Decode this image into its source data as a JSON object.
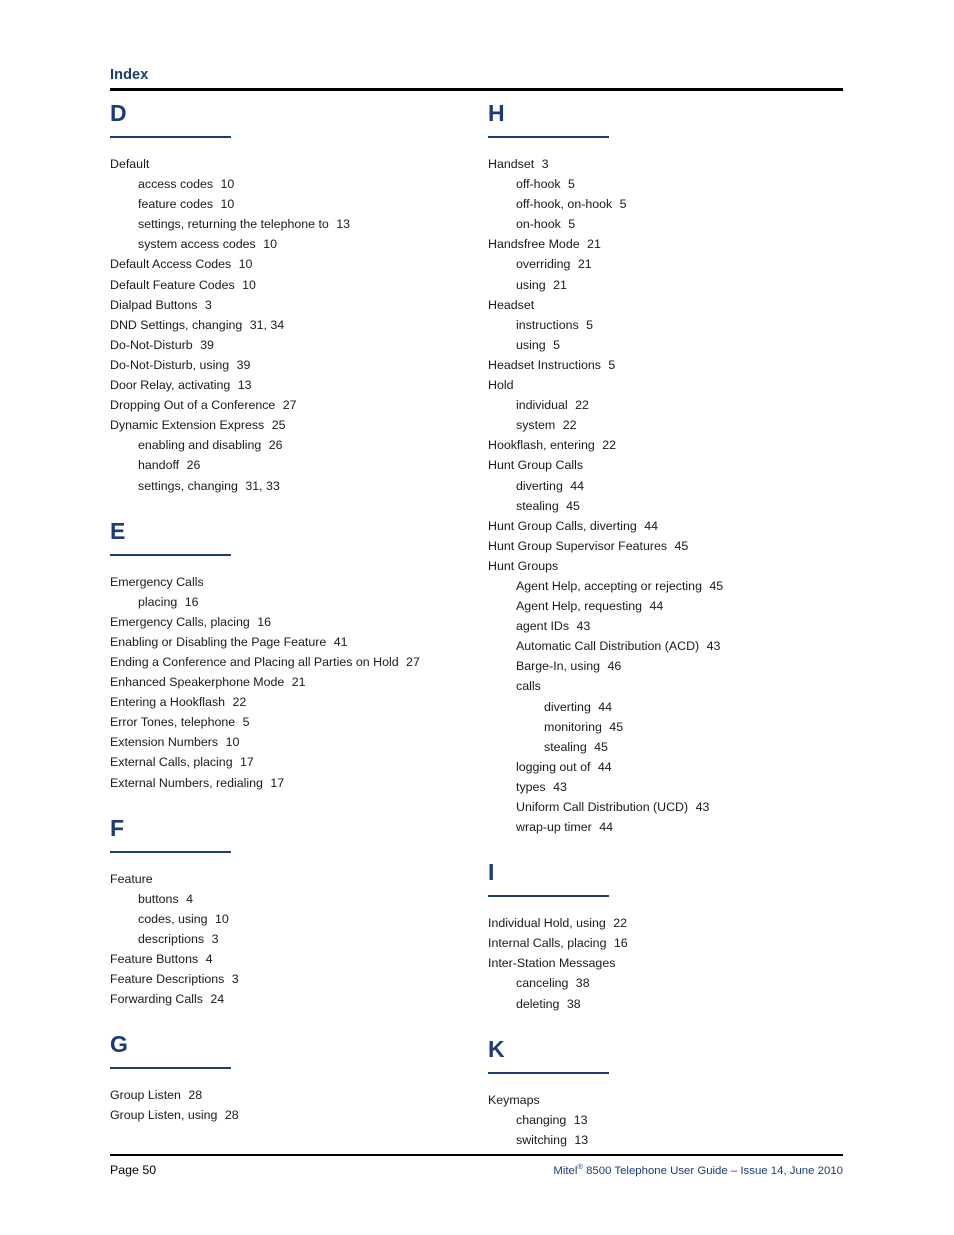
{
  "header": {
    "title": "Index"
  },
  "footer": {
    "page_label": "Page 50",
    "guide_prefix": "Mitel",
    "guide_mark": "®",
    "guide_suffix": " 8500 Telephone User Guide – Issue 14, June 2010"
  },
  "colors": {
    "navy": "#1b3c78",
    "rule_black": "#000000",
    "body_text": "#1a1a1a"
  },
  "columns": [
    {
      "name": "left-column",
      "groups": [
        {
          "letter": "D",
          "entries": [
            {
              "level": 0,
              "text": "Default",
              "pages": ""
            },
            {
              "level": 1,
              "text": "access codes",
              "pages": "10"
            },
            {
              "level": 1,
              "text": "feature codes",
              "pages": "10"
            },
            {
              "level": 1,
              "text": "settings, returning the telephone to",
              "pages": "13"
            },
            {
              "level": 1,
              "text": "system access codes",
              "pages": "10"
            },
            {
              "level": 0,
              "text": "Default Access Codes",
              "pages": "10"
            },
            {
              "level": 0,
              "text": "Default Feature Codes",
              "pages": "10"
            },
            {
              "level": 0,
              "text": "Dialpad Buttons",
              "pages": "3"
            },
            {
              "level": 0,
              "text": "DND Settings, changing",
              "pages": "31,  34"
            },
            {
              "level": 0,
              "text": "Do-Not-Disturb",
              "pages": "39"
            },
            {
              "level": 0,
              "text": "Do-Not-Disturb, using",
              "pages": "39"
            },
            {
              "level": 0,
              "text": "Door Relay, activating",
              "pages": "13"
            },
            {
              "level": 0,
              "text": "Dropping Out of a Conference",
              "pages": "27"
            },
            {
              "level": 0,
              "text": "Dynamic Extension Express",
              "pages": "25"
            },
            {
              "level": 1,
              "text": "enabling and disabling",
              "pages": "26"
            },
            {
              "level": 1,
              "text": "handoff",
              "pages": "26"
            },
            {
              "level": 1,
              "text": "settings, changing",
              "pages": "31,  33"
            }
          ]
        },
        {
          "letter": "E",
          "entries": [
            {
              "level": 0,
              "text": "Emergency Calls",
              "pages": ""
            },
            {
              "level": 1,
              "text": "placing",
              "pages": "16"
            },
            {
              "level": 0,
              "text": "Emergency Calls, placing",
              "pages": "16"
            },
            {
              "level": 0,
              "text": "Enabling or Disabling the Page Feature",
              "pages": "41"
            },
            {
              "level": 0,
              "text": "Ending a Conference and Placing all Parties on Hold",
              "pages": "27"
            },
            {
              "level": 0,
              "text": "Enhanced Speakerphone Mode",
              "pages": "21"
            },
            {
              "level": 0,
              "text": "Entering a Hookflash",
              "pages": "22"
            },
            {
              "level": 0,
              "text": "Error Tones, telephone",
              "pages": "5"
            },
            {
              "level": 0,
              "text": "Extension Numbers",
              "pages": "10"
            },
            {
              "level": 0,
              "text": "External Calls, placing",
              "pages": "17"
            },
            {
              "level": 0,
              "text": "External Numbers, redialing",
              "pages": "17"
            }
          ]
        },
        {
          "letter": "F",
          "entries": [
            {
              "level": 0,
              "text": "Feature",
              "pages": ""
            },
            {
              "level": 1,
              "text": "buttons",
              "pages": "4"
            },
            {
              "level": 1,
              "text": "codes, using",
              "pages": "10"
            },
            {
              "level": 1,
              "text": "descriptions",
              "pages": "3"
            },
            {
              "level": 0,
              "text": "Feature Buttons",
              "pages": "4"
            },
            {
              "level": 0,
              "text": "Feature Descriptions",
              "pages": "3"
            },
            {
              "level": 0,
              "text": "Forwarding Calls",
              "pages": "24"
            }
          ]
        },
        {
          "letter": "G",
          "entries": [
            {
              "level": 0,
              "text": "Group Listen",
              "pages": "28"
            },
            {
              "level": 0,
              "text": "Group Listen, using",
              "pages": "28"
            }
          ]
        }
      ]
    },
    {
      "name": "right-column",
      "groups": [
        {
          "letter": "H",
          "entries": [
            {
              "level": 0,
              "text": "Handset",
              "pages": "3"
            },
            {
              "level": 1,
              "text": "off-hook",
              "pages": "5"
            },
            {
              "level": 1,
              "text": "off-hook, on-hook",
              "pages": "5"
            },
            {
              "level": 1,
              "text": "on-hook",
              "pages": "5"
            },
            {
              "level": 0,
              "text": "Handsfree Mode",
              "pages": "21"
            },
            {
              "level": 1,
              "text": "overriding",
              "pages": "21"
            },
            {
              "level": 1,
              "text": "using",
              "pages": "21"
            },
            {
              "level": 0,
              "text": "Headset",
              "pages": ""
            },
            {
              "level": 1,
              "text": "instructions",
              "pages": "5"
            },
            {
              "level": 1,
              "text": "using",
              "pages": "5"
            },
            {
              "level": 0,
              "text": "Headset Instructions",
              "pages": "5"
            },
            {
              "level": 0,
              "text": "Hold",
              "pages": ""
            },
            {
              "level": 1,
              "text": "individual",
              "pages": "22"
            },
            {
              "level": 1,
              "text": "system",
              "pages": "22"
            },
            {
              "level": 0,
              "text": "Hookflash, entering",
              "pages": "22"
            },
            {
              "level": 0,
              "text": "Hunt Group Calls",
              "pages": ""
            },
            {
              "level": 1,
              "text": "diverting",
              "pages": "44"
            },
            {
              "level": 1,
              "text": "stealing",
              "pages": "45"
            },
            {
              "level": 0,
              "text": "Hunt Group Calls, diverting",
              "pages": "44"
            },
            {
              "level": 0,
              "text": "Hunt Group Supervisor Features",
              "pages": "45"
            },
            {
              "level": 0,
              "text": "Hunt Groups",
              "pages": ""
            },
            {
              "level": 1,
              "text": "Agent Help, accepting or rejecting",
              "pages": "45"
            },
            {
              "level": 1,
              "text": "Agent Help, requesting",
              "pages": "44"
            },
            {
              "level": 1,
              "text": "agent IDs",
              "pages": "43"
            },
            {
              "level": 1,
              "text": "Automatic Call Distribution (ACD)",
              "pages": "43"
            },
            {
              "level": 1,
              "text": "Barge-In, using",
              "pages": "46"
            },
            {
              "level": 1,
              "text": "calls",
              "pages": ""
            },
            {
              "level": 2,
              "text": "diverting",
              "pages": "44"
            },
            {
              "level": 2,
              "text": "monitoring",
              "pages": "45"
            },
            {
              "level": 2,
              "text": "stealing",
              "pages": "45"
            },
            {
              "level": 1,
              "text": "logging out of",
              "pages": "44"
            },
            {
              "level": 1,
              "text": "types",
              "pages": "43"
            },
            {
              "level": 1,
              "text": "Uniform Call Distribution (UCD)",
              "pages": "43"
            },
            {
              "level": 1,
              "text": "wrap-up timer",
              "pages": "44"
            }
          ]
        },
        {
          "letter": "I",
          "entries": [
            {
              "level": 0,
              "text": "Individual Hold, using",
              "pages": "22"
            },
            {
              "level": 0,
              "text": "Internal Calls, placing",
              "pages": "16"
            },
            {
              "level": 0,
              "text": "Inter-Station Messages",
              "pages": ""
            },
            {
              "level": 1,
              "text": "canceling",
              "pages": "38"
            },
            {
              "level": 1,
              "text": "deleting",
              "pages": "38"
            }
          ]
        },
        {
          "letter": "K",
          "entries": [
            {
              "level": 0,
              "text": "Keymaps",
              "pages": ""
            },
            {
              "level": 1,
              "text": "changing",
              "pages": "13"
            },
            {
              "level": 1,
              "text": "switching",
              "pages": "13"
            }
          ]
        }
      ]
    }
  ]
}
